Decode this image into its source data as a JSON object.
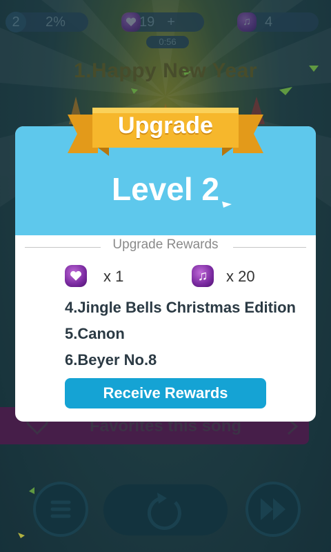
{
  "top_bar": {
    "level_number": "2",
    "progress_percent": "2%",
    "hearts": "19",
    "hearts_plus": "+",
    "notes": "4",
    "timer": "0:56"
  },
  "song_title": "1.Happy New Year",
  "favorites_text": "Favorites this song",
  "dialog": {
    "ribbon_title": "Upgrade",
    "level_text": "Level 2",
    "section_title": "Upgrade Rewards",
    "rewards": [
      {
        "icon": "heart-gem-icon",
        "amount": "x 1"
      },
      {
        "icon": "note-gem-icon",
        "amount": "x 20"
      }
    ],
    "songs": [
      "4.Jingle Bells Christmas Edition",
      "5.Canon",
      "6.Beyer No.8"
    ],
    "receive_button": "Receive Rewards"
  },
  "colors": {
    "dialog_header": "#5ec8ec",
    "button": "#15a3d4",
    "ribbon": "#f6b72c",
    "gem_purple": "#7a2aa0"
  }
}
